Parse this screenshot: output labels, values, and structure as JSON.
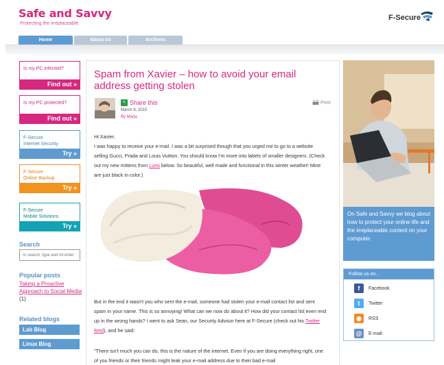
{
  "header": {
    "site_title": "Safe and Savvy",
    "tagline": "Protecting the irreplaceable",
    "brand": "F-Secure"
  },
  "nav": {
    "tabs": [
      {
        "label": "Home",
        "active": true
      },
      {
        "label": "About Us",
        "active": false
      },
      {
        "label": "Archives",
        "active": false
      }
    ]
  },
  "sidebar": {
    "promos": [
      {
        "title": "Is my PC infected?",
        "button": "Find out »",
        "color": "#d6287f"
      },
      {
        "title": "Is my PC protected?",
        "button": "Find out »",
        "color": "#d6287f"
      },
      {
        "title": "F-Secure\nInternet Security",
        "button": "Try »",
        "color": "#5e9bd1"
      },
      {
        "title": "F-Secure\nOnline Backup",
        "button": "Try »",
        "color": "#f0931f"
      },
      {
        "title": "F-Secure\nMobile Solutions",
        "button": "Try »",
        "color": "#14a2b4"
      }
    ],
    "search_heading": "Search",
    "search_placeholder": "To search, type and hit enter",
    "popular_heading": "Popular posts",
    "popular_link": "Taking a Proactive Approach to Social Media",
    "popular_count": "(1)",
    "related_heading": "Related blogs",
    "related": [
      "Lab Blog",
      "Linux Blog"
    ]
  },
  "post": {
    "title": "Spam from Xavier – how to avoid your email address getting stolen",
    "share_label": "Share this",
    "date": "March 8, 2010",
    "by": "By Marja",
    "print_label": "Print",
    "greeting": "Hi Xavier,",
    "p1_before_link": "I was happy to receive your e-mail. I was a bit surprised though that you urged me to go to a website selling Gucci, Prada and Louis Vuitton. You should know I'm more into labels of smaller designers. (Check out my new mittens from ",
    "p1_link": "Lumi",
    "p1_after_link": " below. So beautiful, well made and functional in this winter weather! Mine are just black in color.)",
    "p2_before_link": "But in the end it wasn't you who sent the e-mail, someone had stolen your e-mail contact list and sent spam in your name. This is so annoying! What can we now do about it? How did your contact list even end up in the wrong hands? I went to ask Sean, our Security Advisor here at F-Secure (check out his ",
    "p2_link": "Twitter feed",
    "p2_after_link": "), and he said:",
    "p3": "\"There isn't much you can do, this is the nature of the internet. Even if you are doing everything right, one of you friends or their friends might leak your e-mail address due to their bad e-mail"
  },
  "right": {
    "about_text": "On Safe and Savvy we blog about how to protect your online life and the irreplaceable content on your computer.",
    "follow_heading": "Follow us on...",
    "follow_items": [
      {
        "label": "Facebook",
        "icon": "facebook-icon",
        "color": "#3b5998"
      },
      {
        "label": "Twitter",
        "icon": "twitter-icon",
        "color": "#55acee"
      },
      {
        "label": "RSS",
        "icon": "rss-icon",
        "color": "#f08a24"
      },
      {
        "label": "E-mail",
        "icon": "email-icon",
        "color": "#6b8fc4"
      }
    ]
  }
}
